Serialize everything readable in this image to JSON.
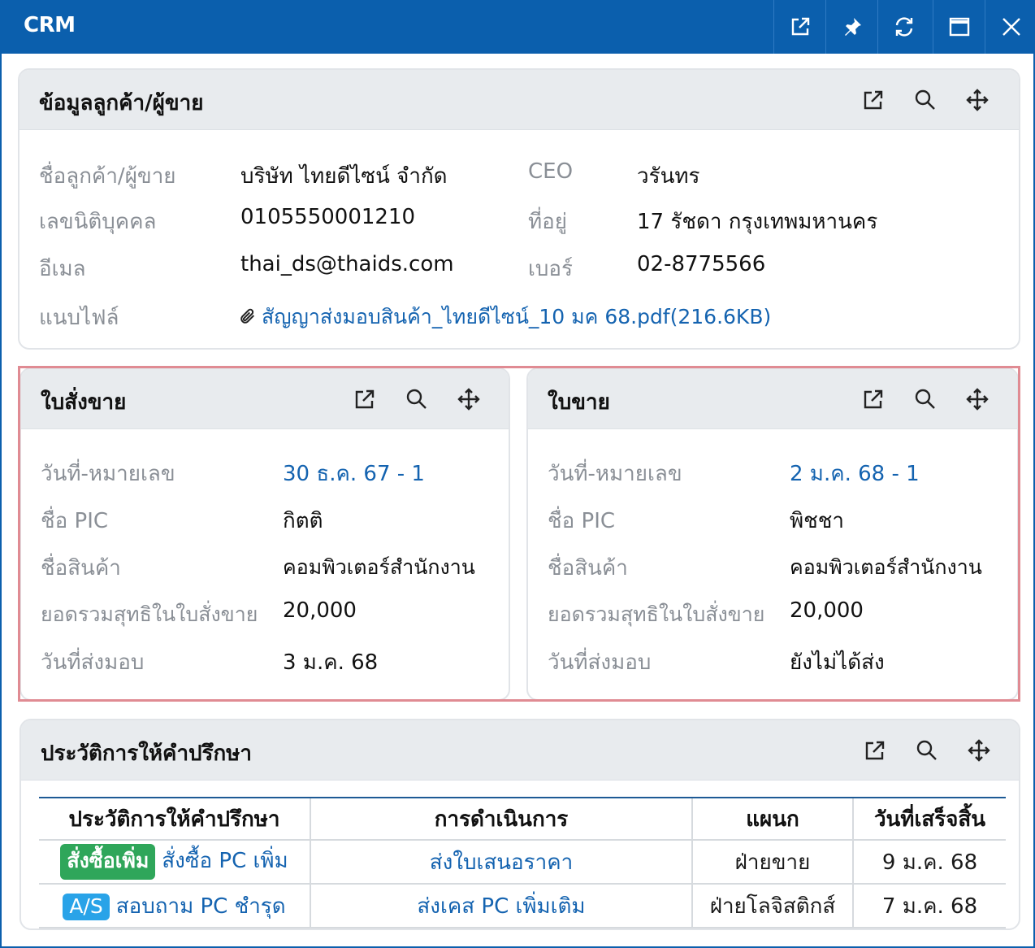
{
  "window": {
    "title": "CRM",
    "controls": [
      "external-link-icon",
      "pin-icon",
      "refresh-icon",
      "maximize-icon",
      "close-icon"
    ]
  },
  "customer": {
    "title": "ข้อมูลลูกค้า/ผู้ขาย",
    "fields": {
      "name_label": "ชื่อลูกค้า/ผู้ขาย",
      "name_value": "บริษัท ไทยดีไซน์ จำกัด",
      "tax_label": "เลขนิติบุคคล",
      "tax_value": "0105550001210",
      "email_label": "อีเมล",
      "email_value": "thai_ds@thaids.com",
      "attach_label": "แนบไฟล์",
      "attach_value": "สัญญาส่งมอบสินค้า_ไทยดีไซน์_10 มค 68.pdf(216.6KB)",
      "ceo_label": "CEO",
      "ceo_value": "วรันทร",
      "address_label": "ที่อยู่",
      "address_value": "17 รัชดา กรุงเทพมหานคร",
      "phone_label": "เบอร์",
      "phone_value": "02-8775566"
    }
  },
  "sales_order": {
    "title": "ใบสั่งขาย",
    "date_label": "วันที่-หมายเลข",
    "date_value": "30 ธ.ค. 67 - 1",
    "pic_label": "ชื่อ PIC",
    "pic_value": "กิตติ",
    "product_label": "ชื่อสินค้า",
    "product_value": "คอมพิวเตอร์สำนักงาน",
    "total_label": "ยอดรวมสุทธิในใบสั่งขาย",
    "total_value": "20,000",
    "delivery_label": "วันที่ส่งมอบ",
    "delivery_value": "3 ม.ค. 68"
  },
  "invoice": {
    "title": "ใบขาย",
    "date_label": "วันที่-หมายเลข",
    "date_value": "2 ม.ค. 68 - 1",
    "pic_label": "ชื่อ PIC",
    "pic_value": "พิชชา",
    "product_label": "ชื่อสินค้า",
    "product_value": "คอมพิวเตอร์สำนักงาน",
    "total_label": "ยอดรวมสุทธิในใบสั่งขาย",
    "total_value": "20,000",
    "delivery_label": "วันที่ส่งมอบ",
    "delivery_value": "ยังไม่ได้ส่ง"
  },
  "history": {
    "title": "ประวัติการให้คำปรึกษา",
    "columns": [
      "ประวัติการให้คำปรึกษา",
      "การดำเนินการ",
      "แผนก",
      "วันที่เสร็จสิ้น"
    ],
    "rows": [
      {
        "badge": "สั่งซื้อเพิ่ม",
        "badge_color": "#2fa65a",
        "subject": "สั่งซื้อ PC เพิ่ม",
        "action": "ส่งใบเสนอราคา",
        "department": "ฝ่ายขาย",
        "date": "9 ม.ค. 68"
      },
      {
        "badge": "A/S",
        "badge_color": "#29a3e8",
        "subject": "สอบถาม PC ชำรุด",
        "action": "ส่งเคส PC เพิ่มเติม",
        "department": "ฝ่ายโลจิสติกส์",
        "date": "7 ม.ค. 68"
      }
    ]
  },
  "colors": {
    "titlebar": "#0b5fad",
    "link": "#1463b0",
    "highlight_border": "#e08b93"
  }
}
